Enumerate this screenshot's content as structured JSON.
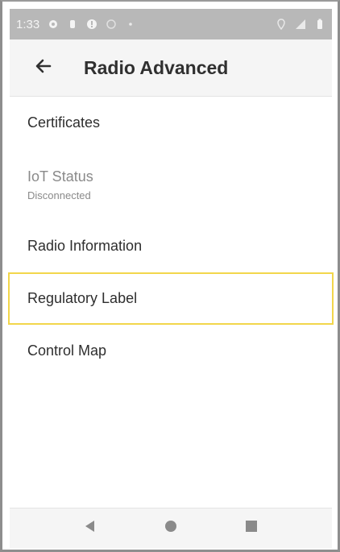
{
  "status_bar": {
    "time": "1:33",
    "left_icons": [
      "gear-icon",
      "notification-icon",
      "alert-icon",
      "vpn-icon",
      "dot-icon"
    ],
    "right_icons": [
      "location-icon",
      "signal-icon",
      "battery-icon"
    ]
  },
  "app_bar": {
    "title": "Radio Advanced",
    "back_icon": "arrow-left-icon"
  },
  "list": {
    "certificates": {
      "title": "Certificates"
    },
    "iot_status": {
      "title": "IoT Status",
      "subtitle": "Disconnected"
    },
    "radio_information": {
      "title": "Radio Information"
    },
    "regulatory_label": {
      "title": "Regulatory Label"
    },
    "control_map": {
      "title": "Control Map"
    }
  },
  "nav_bar": {
    "buttons": [
      "back-triangle-icon",
      "home-circle-icon",
      "recents-square-icon"
    ]
  },
  "colors": {
    "highlight": "#f2d64b",
    "status_bar_bg": "#b8b8b8",
    "app_bar_bg": "#f5f5f5"
  }
}
